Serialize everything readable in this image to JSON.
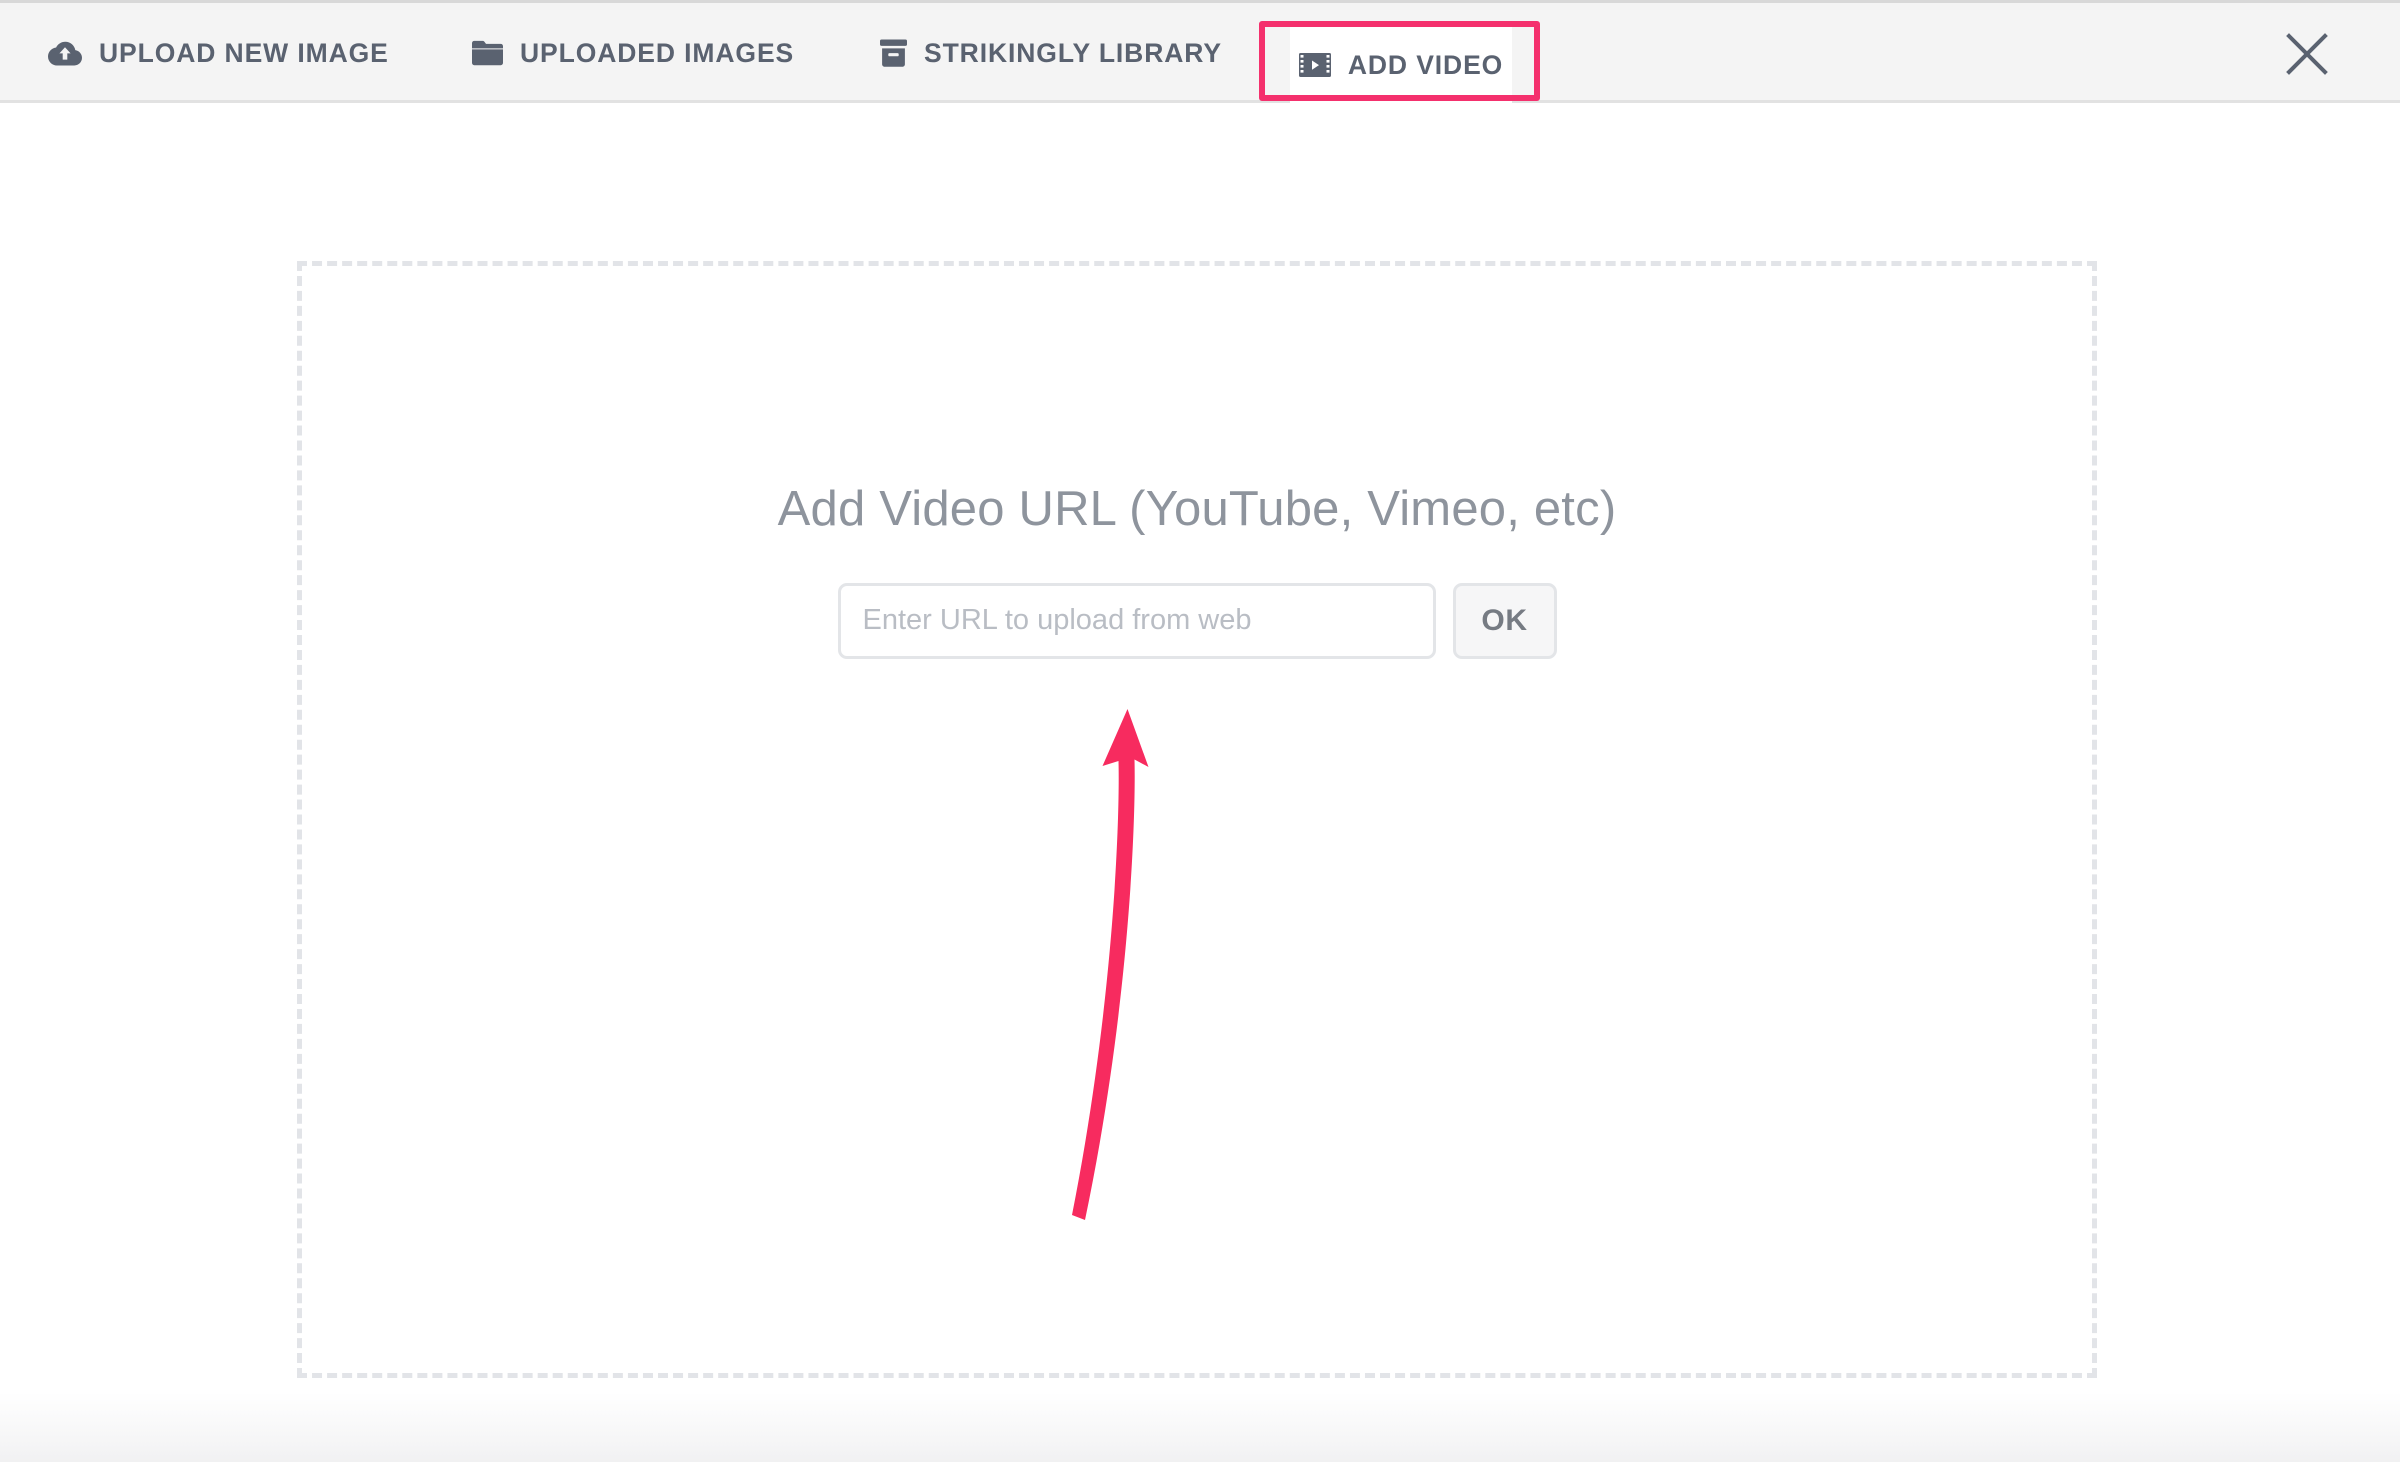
{
  "header": {
    "tabs": [
      {
        "id": "upload-new-image",
        "label": "UPLOAD NEW IMAGE",
        "icon": "cloud-upload-icon",
        "active": false
      },
      {
        "id": "uploaded-images",
        "label": "UPLOADED IMAGES",
        "icon": "folder-icon",
        "active": false
      },
      {
        "id": "strikingly-library",
        "label": "STRIKINGLY LIBRARY",
        "icon": "archive-box-icon",
        "active": false
      },
      {
        "id": "add-video",
        "label": "ADD VIDEO",
        "icon": "video-film-icon",
        "active": true
      }
    ],
    "close_icon": "close-icon",
    "tab_text_color": "#5a6270",
    "bar_background": "#f4f4f4"
  },
  "main": {
    "title": "Add Video URL (YouTube, Vimeo, etc)",
    "url_input": {
      "value": "",
      "placeholder": "Enter URL to upload from web"
    },
    "ok_label": "OK",
    "dropzone_border_color": "#e2e4e8"
  },
  "annotations": {
    "highlight_color": "#f4306d",
    "highlight_target": "add-video",
    "arrow_color": "#f8three",
    "arrow_points_to": "url-input"
  }
}
